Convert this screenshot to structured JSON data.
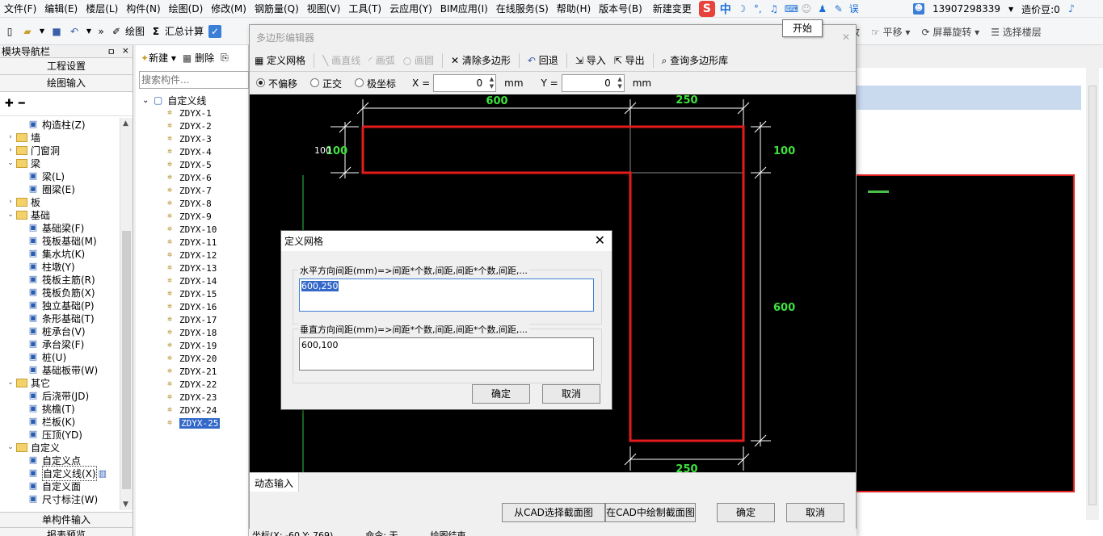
{
  "menu": {
    "items": [
      "文件(F)",
      "编辑(E)",
      "楼层(L)",
      "构件(N)",
      "绘图(D)",
      "修改(M)",
      "钢筋量(Q)",
      "视图(V)",
      "工具(T)",
      "云应用(Y)",
      "BIM应用(I)",
      "在线服务(S)",
      "帮助(H)",
      "版本号(B)",
      "新建变更"
    ],
    "err_text": "误",
    "account": "13907298339",
    "coins": "造价豆:0"
  },
  "tooltip": "开始",
  "toolbar": {
    "draw": "绘图",
    "sum": "汇总计算",
    "zoom": "缩放",
    "pan": "平移",
    "rotate": "屏幕旋转",
    "floor": "选择楼层"
  },
  "nav": {
    "title": "模块导航栏",
    "pin": "ㅁ",
    "close": "×",
    "btn_project": "工程设置",
    "btn_draw": "绘图输入",
    "tree": [
      {
        "label": "构造柱(Z)",
        "level": 2,
        "icon": "column-icon"
      },
      {
        "label": "墙",
        "level": 1,
        "toggle": ">"
      },
      {
        "label": "门窗洞",
        "level": 1,
        "toggle": ">"
      },
      {
        "label": "梁",
        "level": 1,
        "toggle": "v"
      },
      {
        "label": "梁(L)",
        "level": 2,
        "icon": "beam-icon"
      },
      {
        "label": "圈梁(E)",
        "level": 2,
        "icon": "ring-beam-icon"
      },
      {
        "label": "板",
        "level": 1,
        "toggle": ">"
      },
      {
        "label": "基础",
        "level": 1,
        "toggle": "v"
      },
      {
        "label": "基础梁(F)",
        "level": 2,
        "icon": "foundation-beam-icon"
      },
      {
        "label": "筏板基础(M)",
        "level": 2,
        "icon": "raft-icon"
      },
      {
        "label": "集水坑(K)",
        "level": 2,
        "icon": "sump-icon"
      },
      {
        "label": "柱墩(Y)",
        "level": 2,
        "icon": "pier-icon"
      },
      {
        "label": "筏板主筋(R)",
        "level": 2,
        "icon": "raft-rebar-icon"
      },
      {
        "label": "筏板负筋(X)",
        "level": 2,
        "icon": "raft-neg-rebar-icon"
      },
      {
        "label": "独立基础(P)",
        "level": 2,
        "icon": "isolated-footing-icon"
      },
      {
        "label": "条形基础(T)",
        "level": 2,
        "icon": "strip-footing-icon"
      },
      {
        "label": "桩承台(V)",
        "level": 2,
        "icon": "pile-cap-icon"
      },
      {
        "label": "承台梁(F)",
        "level": 2,
        "icon": "cap-beam-icon"
      },
      {
        "label": "桩(U)",
        "level": 2,
        "icon": "pile-icon"
      },
      {
        "label": "基础板带(W)",
        "level": 2,
        "icon": "slab-strip-icon"
      },
      {
        "label": "其它",
        "level": 1,
        "toggle": "v"
      },
      {
        "label": "后浇带(JD)",
        "level": 2,
        "icon": "post-pour-icon"
      },
      {
        "label": "挑檐(T)",
        "level": 2,
        "icon": "eave-icon"
      },
      {
        "label": "栏板(K)",
        "level": 2,
        "icon": "parapet-icon"
      },
      {
        "label": "压顶(YD)",
        "level": 2,
        "icon": "coping-icon"
      },
      {
        "label": "自定义",
        "level": 1,
        "toggle": "v"
      },
      {
        "label": "自定义点",
        "level": 2,
        "icon": "custom-point-icon"
      },
      {
        "label": "自定义线(X)",
        "level": 2,
        "icon": "custom-line-icon",
        "selected": true
      },
      {
        "label": "自定义面",
        "level": 2,
        "icon": "custom-face-icon"
      },
      {
        "label": "尺寸标注(W)",
        "level": 2,
        "icon": "dimension-icon"
      }
    ],
    "btn_single": "单构件输入",
    "btn_report": "报表预览"
  },
  "components": {
    "new_label": "新建",
    "delete_label": "删除",
    "search_placeholder": "搜索构件...",
    "root": "自定义线",
    "items": [
      "ZDYX-1",
      "ZDYX-2",
      "ZDYX-3",
      "ZDYX-4",
      "ZDYX-5",
      "ZDYX-6",
      "ZDYX-7",
      "ZDYX-8",
      "ZDYX-9",
      "ZDYX-10",
      "ZDYX-11",
      "ZDYX-12",
      "ZDYX-13",
      "ZDYX-14",
      "ZDYX-15",
      "ZDYX-16",
      "ZDYX-17",
      "ZDYX-18",
      "ZDYX-19",
      "ZDYX-20",
      "ZDYX-21",
      "ZDYX-22",
      "ZDYX-23",
      "ZDYX-24",
      "ZDYX-25"
    ],
    "selected": "ZDYX-25"
  },
  "poly": {
    "title": "多边形编辑器",
    "tools": {
      "grid": "定义网格",
      "line": "画直线",
      "arc": "画弧",
      "circle": "画圆",
      "clear": "清除多边形",
      "undo": "回退",
      "import": "导入",
      "export": "导出",
      "query": "查询多边形库"
    },
    "mode_none": "不偏移",
    "mode_ortho": "正交",
    "mode_polar": "极坐标",
    "x_label": "X =",
    "x_value": "0",
    "y_label": "Y =",
    "y_value": "0",
    "unit": "mm",
    "dims": {
      "top_left": "600",
      "top_right": "250",
      "right_top": "100",
      "right_main": "600",
      "bottom": "250",
      "left_small": "100",
      "left_small_overlap": "100"
    },
    "dynamic_tab": "动态输入",
    "btn_cad_select": "从CAD选择截面图",
    "btn_cad_draw": "在CAD中绘制截面图",
    "btn_ok": "确定",
    "btn_cancel": "取消"
  },
  "status": {
    "coords": "坐标(X: -60 Y: 769)",
    "cmd": "命令: 无",
    "draw_end": "绘图结束"
  },
  "grid_dialog": {
    "title": "定义网格",
    "h_label": "水平方向间距(mm)=>间距*个数,间距,间距*个数,间距,...",
    "h_value": "600,250",
    "v_label": "垂直方向间距(mm)=>间距*个数,间距,间距*个数,间距,...",
    "v_value": "600,100",
    "ok": "确定",
    "cancel": "取消"
  },
  "colors": {
    "polygon": "#e41b1b",
    "dimension_text": "#3ee33e",
    "selection": "#3368c9"
  }
}
